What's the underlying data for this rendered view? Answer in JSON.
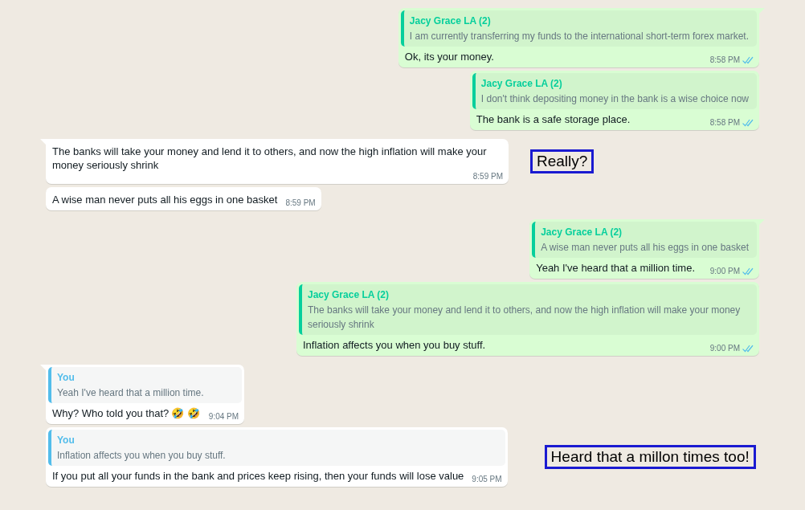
{
  "messages": [
    {
      "outgoing": true,
      "tail": true,
      "quote": {
        "kind": "contact",
        "author": "Jacy Grace LA (2)",
        "text": "I am currently transferring my funds to the international short-term forex market."
      },
      "text": "Ok, its your money.",
      "time": "8:58 PM",
      "read": true
    },
    {
      "outgoing": true,
      "tail": false,
      "quote": {
        "kind": "contact",
        "author": "Jacy Grace LA (2)",
        "text": "I don't think depositing money in the bank is a wise choice now"
      },
      "text": "The bank is a safe storage place.",
      "time": "8:58 PM",
      "read": true
    },
    {
      "outgoing": false,
      "tail": true,
      "text": "The banks will take your money and lend it to others, and now the high inflation will make your money seriously shrink",
      "time": "8:59 PM",
      "annotation": "Really?"
    },
    {
      "outgoing": false,
      "tail": false,
      "text": "A wise man never puts all his eggs in one basket",
      "time": "8:59 PM"
    },
    {
      "outgoing": true,
      "tail": true,
      "quote": {
        "kind": "contact",
        "author": "Jacy Grace LA (2)",
        "text": "A wise man never puts all his eggs in one basket"
      },
      "text": "Yeah I've heard that a million time.",
      "time": "9:00 PM",
      "read": true
    },
    {
      "outgoing": true,
      "tail": false,
      "quote": {
        "kind": "contact",
        "author": "Jacy Grace LA (2)",
        "text": "The banks will take your money and lend it to others, and now the high inflation will make your money seriously shrink"
      },
      "text": "Inflation affects you when you buy stuff.",
      "time": "9:00 PM",
      "read": true
    },
    {
      "outgoing": false,
      "tail": true,
      "quote": {
        "kind": "self",
        "author": "You",
        "text": "Yeah I've heard that a million time."
      },
      "text": "Why? Who told you that? 🤣 🤣",
      "time": "9:04 PM"
    },
    {
      "outgoing": false,
      "tail": false,
      "quote": {
        "kind": "self",
        "author": "You",
        "text": "Inflation affects you when you buy stuff."
      },
      "text": "If you put all your funds in the bank and prices keep rising, then your funds will lose value",
      "time": "9:05 PM",
      "annotation": "Heard that a millon times too!"
    }
  ]
}
